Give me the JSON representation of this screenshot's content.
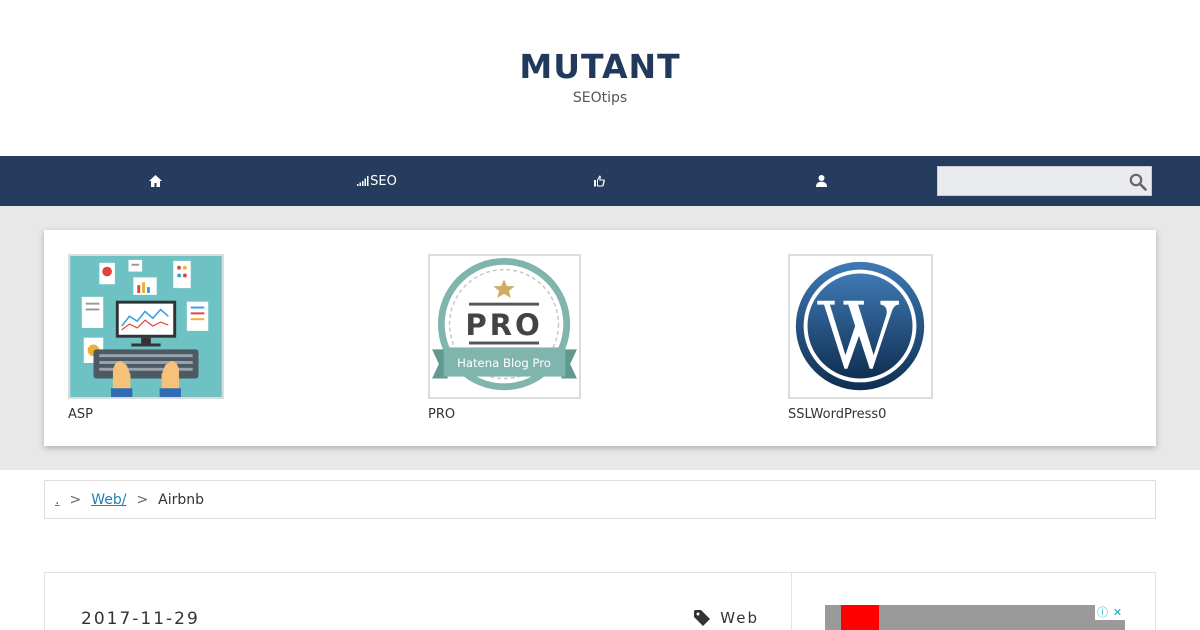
{
  "header": {
    "title": "MUTANT",
    "tagline": "SEOtips"
  },
  "nav": {
    "items": [
      {
        "label": "",
        "icon": "home-icon"
      },
      {
        "label": "SEO",
        "icon": "signal-icon"
      },
      {
        "label": "",
        "icon": "thumbs-up-icon"
      },
      {
        "label": "",
        "icon": "user-icon"
      }
    ],
    "search": {
      "value": "",
      "placeholder": ""
    }
  },
  "featured": [
    {
      "caption": "ASP"
    },
    {
      "caption": "PRO",
      "image_text_main": "PRO",
      "image_text_ribbon": "Hatena Blog Pro"
    },
    {
      "caption": "SSLWordPress0"
    }
  ],
  "breadcrumb": {
    "home": ".",
    "separator": ">",
    "category": "Web/",
    "current": "Airbnb"
  },
  "post": {
    "date": "2017-11-29",
    "category": "Web"
  },
  "ad": {
    "info_icon": "info-icon",
    "close_icon": "close-icon"
  },
  "colors": {
    "title": "#213a5c",
    "nav_bg": "#263c5e",
    "link": "#1f7fb8",
    "band_bg": "#e8e8e8"
  }
}
